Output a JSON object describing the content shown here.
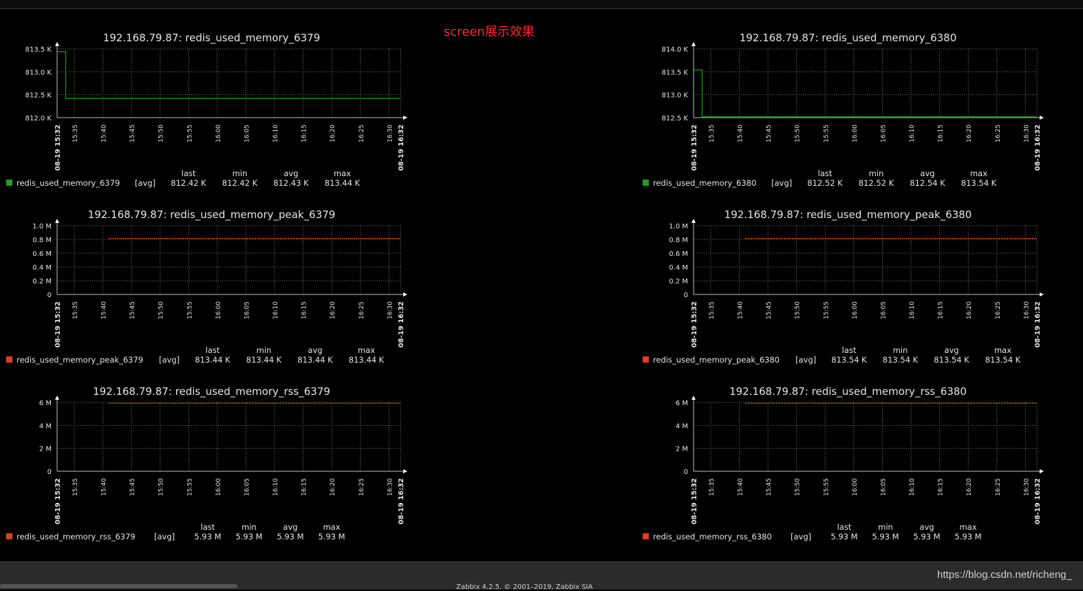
{
  "screen": {
    "title": "screen展示效果"
  },
  "footer": {
    "copyright": "Zabbix 4.2.5. © 2001–2019, Zabbix SIA",
    "watermark": "https://blog.csdn.net/richeng_"
  },
  "colors": {
    "background": "#000000",
    "grid": "#7a7a7a",
    "axis": "#bfbfbf",
    "series_green": "#1ea01e",
    "series_red": "#e03c1e",
    "screen_title": "#ff2a2a"
  },
  "legend_headers": [
    "last",
    "min",
    "avg",
    "max"
  ],
  "chart_data": [
    {
      "type": "line",
      "title": "192.168.79.87: redis_used_memory_6379",
      "x_start_label": "08-19 15:32",
      "x_end_label": "08-19 16:32",
      "x_ticks": [
        "15:35",
        "15:40",
        "15:45",
        "15:50",
        "15:55",
        "16:00",
        "16:05",
        "16:10",
        "16:15",
        "16:20",
        "16:25",
        "16:30"
      ],
      "xlim_minutes": [
        0,
        60
      ],
      "y_ticks": [
        "812.0 K",
        "812.5 K",
        "813.0 K",
        "813.5 K"
      ],
      "ylim": [
        812.0,
        813.5
      ],
      "y_unit": "K",
      "series": [
        {
          "name": "redis_used_memory_6379",
          "agg": "[avg]",
          "color": "#1ea01e",
          "points": [
            [
              0,
              813.44
            ],
            [
              1.5,
              813.44
            ],
            [
              1.5,
              812.42
            ],
            [
              60,
              812.42
            ]
          ],
          "last": "812.42 K",
          "min": "812.42 K",
          "avg": "812.43 K",
          "max": "813.44 K"
        }
      ]
    },
    {
      "type": "line",
      "title": "192.168.79.87: redis_used_memory_6380",
      "x_start_label": "08-19 15:32",
      "x_end_label": "08-19 16:32",
      "x_ticks": [
        "15:35",
        "15:40",
        "15:45",
        "15:50",
        "15:55",
        "16:00",
        "16:05",
        "16:10",
        "16:15",
        "16:20",
        "16:25",
        "16:30"
      ],
      "xlim_minutes": [
        0,
        60
      ],
      "y_ticks": [
        "812.5 K",
        "813.0 K",
        "813.5 K",
        "814.0 K"
      ],
      "ylim": [
        812.5,
        814.0
      ],
      "y_unit": "K",
      "series": [
        {
          "name": "redis_used_memory_6380",
          "agg": "[avg]",
          "color": "#1ea01e",
          "points": [
            [
              0,
              813.54
            ],
            [
              1.5,
              813.54
            ],
            [
              1.5,
              812.52
            ],
            [
              60,
              812.52
            ]
          ],
          "last": "812.52 K",
          "min": "812.52 K",
          "avg": "812.54 K",
          "max": "813.54 K"
        }
      ]
    },
    {
      "type": "line",
      "title": "192.168.79.87: redis_used_memory_peak_6379",
      "x_start_label": "08-19 15:32",
      "x_end_label": "08-19 16:32",
      "x_ticks": [
        "15:35",
        "15:40",
        "15:45",
        "15:50",
        "15:55",
        "16:00",
        "16:05",
        "16:10",
        "16:15",
        "16:20",
        "16:25",
        "16:30"
      ],
      "xlim_minutes": [
        0,
        60
      ],
      "y_ticks": [
        "0",
        "0.2 M",
        "0.4 M",
        "0.6 M",
        "0.8 M",
        "1.0 M"
      ],
      "ylim": [
        0,
        1.0
      ],
      "y_unit": "M",
      "series": [
        {
          "name": "redis_used_memory_peak_6379",
          "agg": "[avg]",
          "color": "#e03c1e",
          "dashed": true,
          "points": [
            [
              9,
              0.8134
            ],
            [
              60,
              0.8134
            ]
          ],
          "last": "813.44 K",
          "min": "813.44 K",
          "avg": "813.44 K",
          "max": "813.44 K"
        }
      ]
    },
    {
      "type": "line",
      "title": "192.168.79.87: redis_used_memory_peak_6380",
      "x_start_label": "08-19 15:32",
      "x_end_label": "08-19 16:32",
      "x_ticks": [
        "15:35",
        "15:40",
        "15:45",
        "15:50",
        "15:55",
        "16:00",
        "16:05",
        "16:10",
        "16:15",
        "16:20",
        "16:25",
        "16:30"
      ],
      "xlim_minutes": [
        0,
        60
      ],
      "y_ticks": [
        "0",
        "0.2 M",
        "0.4 M",
        "0.6 M",
        "0.8 M",
        "1.0 M"
      ],
      "ylim": [
        0,
        1.0
      ],
      "y_unit": "M",
      "series": [
        {
          "name": "redis_used_memory_peak_6380",
          "agg": "[avg]",
          "color": "#e03c1e",
          "dashed": true,
          "points": [
            [
              9,
              0.8135
            ],
            [
              60,
              0.8135
            ]
          ],
          "last": "813.54 K",
          "min": "813.54 K",
          "avg": "813.54 K",
          "max": "813.54 K"
        }
      ]
    },
    {
      "type": "line",
      "title": "192.168.79.87: redis_used_memory_rss_6379",
      "x_start_label": "08-19 15:32",
      "x_end_label": "08-19 16:32",
      "x_ticks": [
        "15:35",
        "15:40",
        "15:45",
        "15:50",
        "15:55",
        "16:00",
        "16:05",
        "16:10",
        "16:15",
        "16:20",
        "16:25",
        "16:30"
      ],
      "xlim_minutes": [
        0,
        60
      ],
      "y_ticks": [
        "0",
        "2 M",
        "4 M",
        "6 M"
      ],
      "ylim": [
        0,
        6
      ],
      "y_unit": "M",
      "series": [
        {
          "name": "redis_used_memory_rss_6379",
          "agg": "[avg]",
          "color": "#e03c1e",
          "dashed": true,
          "points": [
            [
              9,
              5.93
            ],
            [
              60,
              5.93
            ]
          ],
          "last": "5.93 M",
          "min": "5.93 M",
          "avg": "5.93 M",
          "max": "5.93 M"
        }
      ]
    },
    {
      "type": "line",
      "title": "192.168.79.87: redis_used_memory_rss_6380",
      "x_start_label": "08-19 15:32",
      "x_end_label": "08-19 16:32",
      "x_ticks": [
        "15:35",
        "15:40",
        "15:45",
        "15:50",
        "15:55",
        "16:00",
        "16:05",
        "16:10",
        "16:15",
        "16:20",
        "16:25",
        "16:30"
      ],
      "xlim_minutes": [
        0,
        60
      ],
      "y_ticks": [
        "0",
        "2 M",
        "4 M",
        "6 M"
      ],
      "ylim": [
        0,
        6
      ],
      "y_unit": "M",
      "series": [
        {
          "name": "redis_used_memory_rss_6380",
          "agg": "[avg]",
          "color": "#e03c1e",
          "dashed": true,
          "points": [
            [
              9,
              5.93
            ],
            [
              60,
              5.93
            ]
          ],
          "last": "5.93 M",
          "min": "5.93 M",
          "avg": "5.93 M",
          "max": "5.93 M"
        }
      ]
    }
  ]
}
